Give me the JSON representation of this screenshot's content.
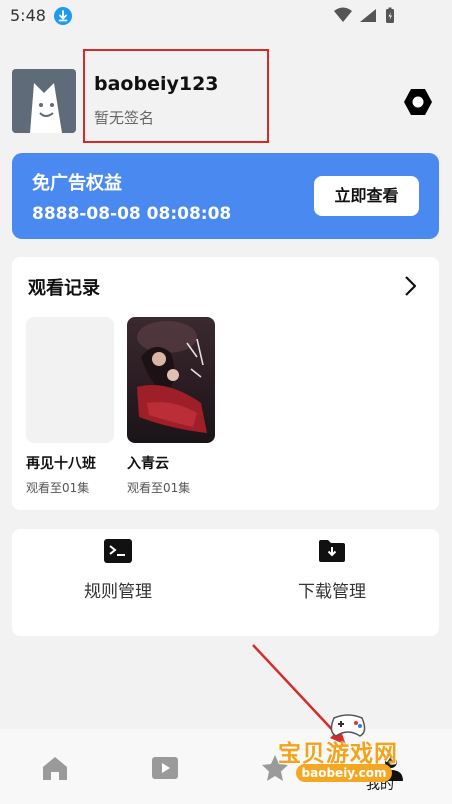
{
  "status_bar": {
    "time": "5:48"
  },
  "profile": {
    "username": "baobeiy123",
    "signature": "暂无签名"
  },
  "vip": {
    "title": "免广告权益",
    "expiry": "8888-08-08 08:08:08",
    "button_label": "立即查看"
  },
  "history": {
    "title": "观看记录",
    "items": [
      {
        "title": "再见十八班",
        "progress": "观看至01集"
      },
      {
        "title": "入青云",
        "progress": "观看至01集"
      }
    ]
  },
  "tools": [
    {
      "label": "规则管理",
      "icon": "terminal-icon"
    },
    {
      "label": "下载管理",
      "icon": "download-folder-icon"
    }
  ],
  "bottom_nav": {
    "mine_label": "我的"
  },
  "watermark": {
    "text": "宝贝游戏网",
    "url": "baobeiy.com"
  },
  "colors": {
    "accent": "#4a89f0",
    "highlight": "#d62b2b",
    "background": "#f2f2f2"
  }
}
